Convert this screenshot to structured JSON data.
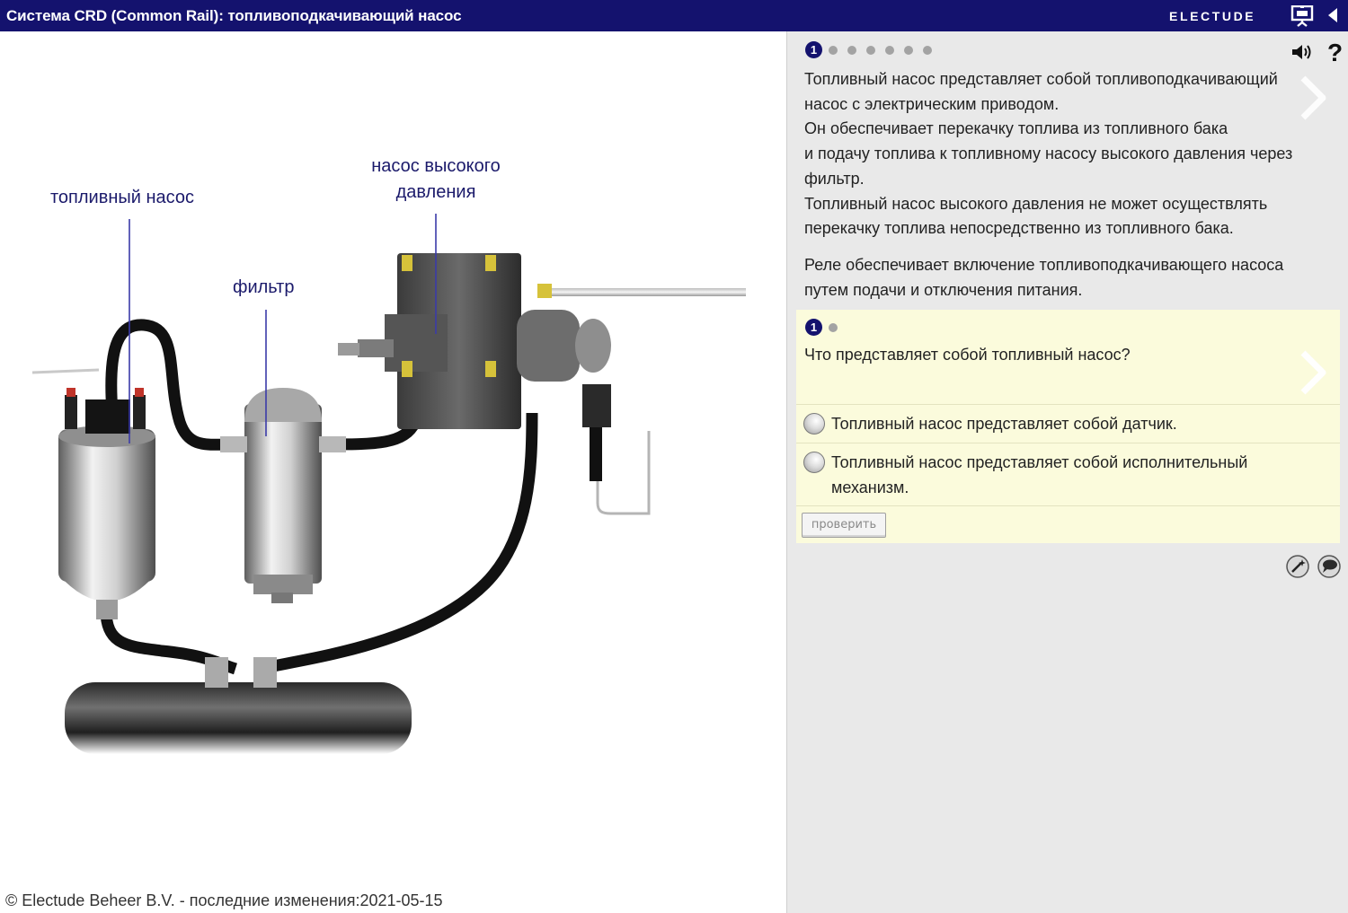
{
  "window": {
    "title": "Система CRD (Common Rail): топливоподкачивающий насос",
    "brand": "ELECTUDE",
    "icons": [
      "presentation-icon",
      "collapse-arrow-icon"
    ]
  },
  "diagram": {
    "labels": {
      "fuel_pump": "топливный насос",
      "filter": "фильтр",
      "hp_pump_line1": "насос высокого",
      "hp_pump_line2": "давления"
    },
    "colors": {
      "label": "#1b1a6b",
      "leader": "#3b3ba8"
    }
  },
  "footer": {
    "text": "© Electude Beheer B.V. - последние изменения:2021-05-15"
  },
  "panel": {
    "pager": {
      "active": "1",
      "total_dots": 7
    },
    "icons": [
      "sound-icon",
      "help-icon",
      "next-arrow-icon"
    ],
    "help_symbol": "?",
    "paragraph1": [
      "Топливный насос представляет собой топливоподкачивающий",
      "насос с электрическим приводом.",
      "Он обеспечивает перекачку топлива из топливного бака",
      "и подачу топлива к топливному насосу высокого давления через",
      "фильтр.",
      "Топливный насос высокого давления не может осуществлять",
      "перекачку топлива непосредственно из топливного бака."
    ],
    "paragraph2": [
      "Реле обеспечивает включение топливоподкачивающего насоса",
      "путем подачи и отключения питания."
    ]
  },
  "quiz": {
    "pager": {
      "active": "1",
      "total_dots": 2
    },
    "question": "Что представляет собой топливный насос?",
    "options": [
      {
        "line1": "Топливный насос представляет собой датчик.",
        "line2": ""
      },
      {
        "line1": "Топливный насос представляет собой исполнительный",
        "line2": "механизм."
      }
    ],
    "check_label": "проверить",
    "background": "#fbfbdc"
  },
  "tools": [
    "magic-wand-icon",
    "comment-icon"
  ],
  "colors": {
    "titlebar": "#14126e",
    "panel": "#e9e9e9",
    "accent": "#14126e"
  }
}
